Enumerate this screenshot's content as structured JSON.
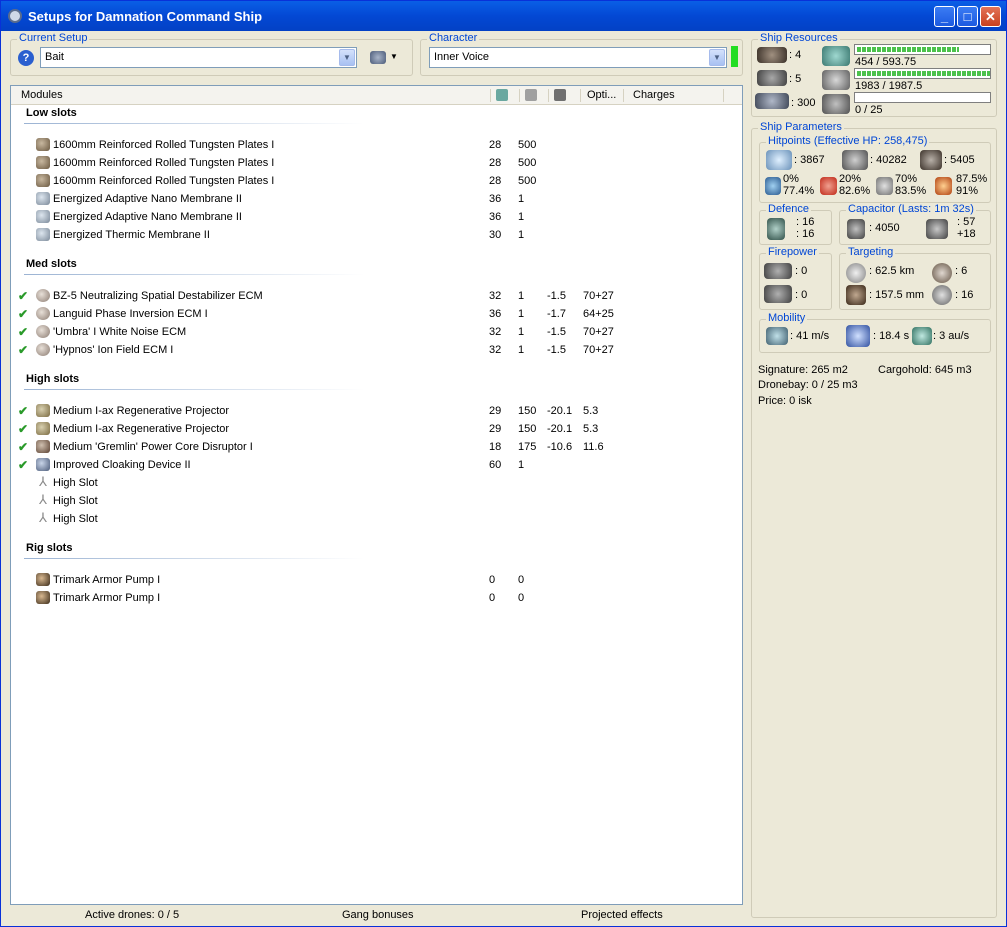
{
  "window": {
    "title": "Setups for Damnation Command Ship"
  },
  "current_setup": {
    "label": "Current Setup",
    "value": "Bait"
  },
  "character": {
    "label": "Character",
    "value": "Inner Voice"
  },
  "modules": {
    "header": {
      "name": "Modules",
      "optimal": "Opti...",
      "charges": "Charges"
    },
    "sections": [
      {
        "title": "Low slots",
        "items": [
          {
            "name": "1600mm Reinforced Rolled Tungsten Plates I",
            "cpu": "28",
            "pg": "500",
            "cap": "",
            "range": "",
            "icon": "armor-plate-icon",
            "active": false
          },
          {
            "name": "1600mm Reinforced Rolled Tungsten Plates I",
            "cpu": "28",
            "pg": "500",
            "cap": "",
            "range": "",
            "icon": "armor-plate-icon",
            "active": false
          },
          {
            "name": "1600mm Reinforced Rolled Tungsten Plates I",
            "cpu": "28",
            "pg": "500",
            "cap": "",
            "range": "",
            "icon": "armor-plate-icon",
            "active": false
          },
          {
            "name": "Energized Adaptive Nano Membrane II",
            "cpu": "36",
            "pg": "1",
            "cap": "",
            "range": "",
            "icon": "membrane-icon",
            "active": false
          },
          {
            "name": "Energized Adaptive Nano Membrane II",
            "cpu": "36",
            "pg": "1",
            "cap": "",
            "range": "",
            "icon": "membrane-icon",
            "active": false
          },
          {
            "name": "Energized Thermic Membrane II",
            "cpu": "30",
            "pg": "1",
            "cap": "",
            "range": "",
            "icon": "membrane-icon",
            "active": false
          }
        ]
      },
      {
        "title": "Med slots",
        "items": [
          {
            "name": "BZ-5 Neutralizing Spatial Destabilizer ECM",
            "cpu": "32",
            "pg": "1",
            "cap": "-1.5",
            "range": "70+27",
            "icon": "ecm-icon",
            "active": true
          },
          {
            "name": "Languid Phase Inversion ECM I",
            "cpu": "36",
            "pg": "1",
            "cap": "-1.7",
            "range": "64+25",
            "icon": "ecm-icon",
            "active": true
          },
          {
            "name": "'Umbra' I White Noise ECM",
            "cpu": "32",
            "pg": "1",
            "cap": "-1.5",
            "range": "70+27",
            "icon": "ecm-icon",
            "active": true
          },
          {
            "name": "'Hypnos' Ion Field ECM I",
            "cpu": "32",
            "pg": "1",
            "cap": "-1.5",
            "range": "70+27",
            "icon": "ecm-icon",
            "active": true
          }
        ]
      },
      {
        "title": "High slots",
        "items": [
          {
            "name": "Medium I-ax Regenerative Projector",
            "cpu": "29",
            "pg": "150",
            "cap": "-20.1",
            "range": "5.3",
            "icon": "projector-icon",
            "active": true
          },
          {
            "name": "Medium I-ax Regenerative Projector",
            "cpu": "29",
            "pg": "150",
            "cap": "-20.1",
            "range": "5.3",
            "icon": "projector-icon",
            "active": true
          },
          {
            "name": "Medium 'Gremlin' Power Core Disruptor I",
            "cpu": "18",
            "pg": "175",
            "cap": "-10.6",
            "range": "11.6",
            "icon": "neutralizer-icon",
            "active": true
          },
          {
            "name": "Improved Cloaking Device II",
            "cpu": "60",
            "pg": "1",
            "cap": "",
            "range": "",
            "icon": "cloak-icon",
            "active": true
          },
          {
            "name": "High Slot",
            "cpu": "",
            "pg": "",
            "cap": "",
            "range": "",
            "icon": "empty-slot-icon",
            "active": false
          },
          {
            "name": "High Slot",
            "cpu": "",
            "pg": "",
            "cap": "",
            "range": "",
            "icon": "empty-slot-icon",
            "active": false
          },
          {
            "name": "High Slot",
            "cpu": "",
            "pg": "",
            "cap": "",
            "range": "",
            "icon": "empty-slot-icon",
            "active": false
          }
        ]
      },
      {
        "title": "Rig slots",
        "items": [
          {
            "name": "Trimark Armor Pump I",
            "cpu": "0",
            "pg": "0",
            "cap": "",
            "range": "",
            "icon": "rig-icon",
            "active": false
          },
          {
            "name": "Trimark Armor Pump I",
            "cpu": "0",
            "pg": "0",
            "cap": "",
            "range": "",
            "icon": "rig-icon",
            "active": false
          }
        ]
      }
    ]
  },
  "status_bar": {
    "drones": "Active drones: 0 / 5",
    "gang": "Gang bonuses",
    "projected": "Projected effects"
  },
  "ship_resources": {
    "label": "Ship Resources",
    "high_slots": ": 4",
    "turret_slots": ": 5",
    "calibration": ": 300",
    "cpu": {
      "text": "454 / 593.75",
      "fraction": 0.765
    },
    "powergrid": {
      "text": "1983 / 1987.5",
      "fraction": 0.998
    },
    "drone_bandwidth": {
      "text": "0 / 25",
      "fraction": 0
    }
  },
  "ship_parameters": {
    "label": "Ship Parameters",
    "hitpoints": {
      "label": "Hitpoints (Effective HP: 258,475)",
      "shield": ": 3867",
      "armor": ": 40282",
      "structure": ": 5405",
      "resists": [
        {
          "top": "0%",
          "bottom": "77.4%"
        },
        {
          "top": "20%",
          "bottom": "82.6%"
        },
        {
          "top": "70%",
          "bottom": "83.5%"
        },
        {
          "top": "87.5%",
          "bottom": "91%"
        }
      ]
    },
    "defence": {
      "label": "Defence",
      "a": ": 16",
      "b": ": 16"
    },
    "capacitor": {
      "label": "Capacitor (Lasts: 1m 32s)",
      "amount": ": 4050",
      "recharge_top": ": 57",
      "recharge_bottom": "+18"
    },
    "firepower": {
      "label": "Firepower",
      "turret": ": 0",
      "missile": ": 0"
    },
    "targeting": {
      "label": "Targeting",
      "range": ": 62.5 km",
      "targets": ": 6",
      "resolution": ": 157.5 mm",
      "sensor": ": 16"
    },
    "mobility": {
      "label": "Mobility",
      "speed": ": 41 m/s",
      "align": ": 18.4 s",
      "warp": ": 3 au/s"
    },
    "signature": "Signature: 265 m2",
    "cargohold": "Cargohold: 645 m3",
    "dronebay": "Dronebay: 0 / 25 m3",
    "price": "Price: 0 isk"
  },
  "colors": {
    "title_bar": "#0348d4",
    "accent_label": "#0046d5",
    "check": "#2a9a2a",
    "bar_fill": "#4cc24c",
    "char_indicator": "#22dd22"
  }
}
